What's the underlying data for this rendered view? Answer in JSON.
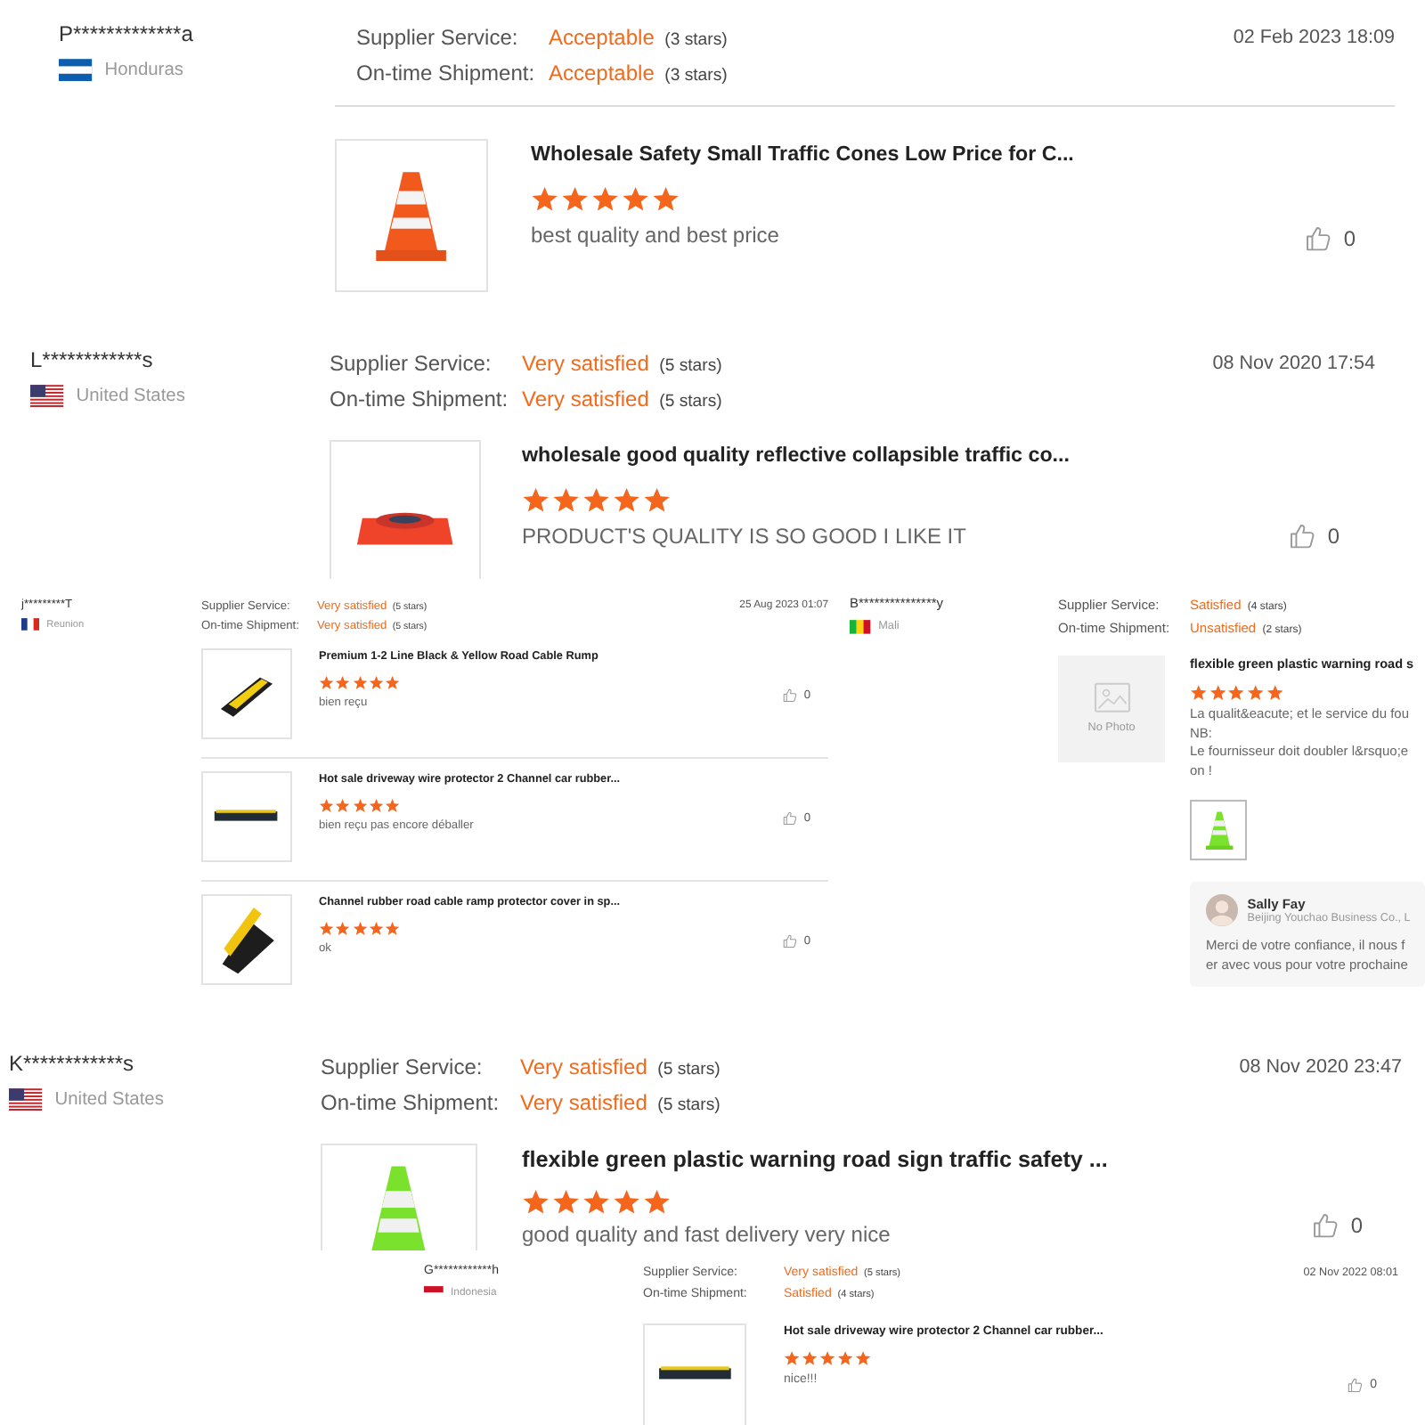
{
  "panels": [
    {
      "reviewer": {
        "name": "P*************a",
        "country": "Honduras"
      },
      "ratings": [
        {
          "label": "Supplier Service:",
          "verdict": "Acceptable",
          "stars_text": "(3 stars)"
        },
        {
          "label": "On-time Shipment:",
          "verdict": "Acceptable",
          "stars_text": "(3 stars)"
        }
      ],
      "date": "02 Feb 2023 18:09",
      "products": [
        {
          "image": {
            "kind": "cone"
          },
          "title": "Wholesale Safety Small Traffic Cones Low Price for C...",
          "stars": 5,
          "comment": "best quality and best price",
          "likes": "0"
        }
      ]
    },
    {
      "reviewer": {
        "name": "L************s",
        "country": "United States"
      },
      "ratings": [
        {
          "label": "Supplier Service:",
          "verdict": "Very satisfied",
          "stars_text": "(5 stars)"
        },
        {
          "label": "On-time Shipment:",
          "verdict": "Very satisfied",
          "stars_text": "(5 stars)"
        }
      ],
      "date": "08 Nov 2020 17:54",
      "products": [
        {
          "image": {
            "kind": "flat-cone"
          },
          "title": "wholesale good quality reflective collapsible traffic co...",
          "stars": 5,
          "comment": "PRODUCT'S QUALITY IS SO GOOD  I LIKE IT",
          "likes": "0"
        }
      ]
    },
    {
      "reviewer": {
        "name": "j*********T",
        "country": "Reunion"
      },
      "ratings": [
        {
          "label": "Supplier Service:",
          "verdict": "Very satisfied",
          "stars_text": "(5 stars)"
        },
        {
          "label": "On-time Shipment:",
          "verdict": "Very satisfied",
          "stars_text": "(5 stars)"
        }
      ],
      "date": "25 Aug 2023 01:07",
      "products": [
        {
          "image": {
            "kind": "ramp-diagonal"
          },
          "title": "Premium 1-2 Line Black & Yellow Road Cable Rump",
          "stars": 5,
          "comment": "bien reçu",
          "likes": "0"
        },
        {
          "image": {
            "kind": "ramp-flat"
          },
          "title": "Hot sale driveway wire protector 2 Channel car rubber...",
          "stars": 5,
          "comment": "bien reçu pas encore déballer",
          "likes": "0"
        },
        {
          "image": {
            "kind": "ramp-open"
          },
          "title": "Channel rubber road cable ramp protector cover in sp...",
          "stars": 5,
          "comment": "ok",
          "likes": "0"
        }
      ]
    },
    {
      "reviewer": {
        "name": "B***************y",
        "country": "Mali"
      },
      "ratings": [
        {
          "label": "Supplier Service:",
          "verdict": "Satisfied",
          "stars_text": "(4 stars)"
        },
        {
          "label": "On-time Shipment:",
          "verdict": "Unsatisfied",
          "stars_text": "(2 stars)"
        }
      ],
      "products": [
        {
          "image": {
            "kind": "no-photo",
            "text": "No Photo"
          },
          "title": "flexible green plastic warning road s",
          "stars": 5,
          "comment": "La qualit&eacute; et le service du fou\nNB:\nLe fournisseur doit doubler l&rsquo;e\non !",
          "photos": [
            {
              "kind": "green-cone"
            }
          ],
          "reply": {
            "name": "Sally Fay",
            "company": "Beijing Youchao Business Co., L",
            "text": "Merci de votre confiance, il nous f\ner avec vous pour votre prochaine"
          }
        }
      ]
    },
    {
      "reviewer": {
        "name": "K************s",
        "country": "United States"
      },
      "ratings": [
        {
          "label": "Supplier Service:",
          "verdict": "Very satisfied",
          "stars_text": "(5 stars)"
        },
        {
          "label": "On-time Shipment:",
          "verdict": "Very satisfied",
          "stars_text": "(5 stars)"
        }
      ],
      "date": "08 Nov 2020 23:47",
      "products": [
        {
          "image": {
            "kind": "green-cone"
          },
          "title": "flexible green plastic warning road sign traffic safety ...",
          "stars": 5,
          "comment": "good quality and fast delivery very nice",
          "likes": "0"
        }
      ]
    },
    {
      "reviewer": {
        "name": "G************h",
        "country": "Indonesia"
      },
      "ratings": [
        {
          "label": "Supplier Service:",
          "verdict": "Very satisfied",
          "stars_text": "(5 stars)"
        },
        {
          "label": "On-time Shipment:",
          "verdict": "Satisfied",
          "stars_text": "(4 stars)"
        }
      ],
      "date": "02 Nov 2022 08:01",
      "products": [
        {
          "image": {
            "kind": "ramp-flat"
          },
          "title": "Hot sale driveway wire protector 2 Channel car rubber...",
          "stars": 5,
          "comment": "nice!!!",
          "likes": "0"
        }
      ]
    }
  ]
}
